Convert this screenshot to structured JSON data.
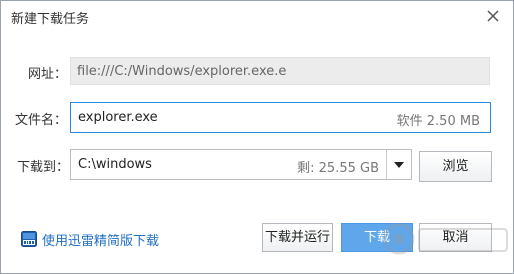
{
  "window": {
    "title": "新建下载任务",
    "close_icon": "close-icon"
  },
  "url_row": {
    "label": "网址：",
    "value": "file:///C:/Windows/explorer.exe.e"
  },
  "name_row": {
    "label": "文件名：",
    "value": "explorer.exe",
    "meta": "软件 2.50 MB"
  },
  "dir_row": {
    "label": "下载到：",
    "value": "C:\\windows",
    "free_space": "剩: 25.55 GB",
    "dropdown_icon": "caret-down-icon"
  },
  "buttons": {
    "browse": "浏览",
    "download_and_run": "下载并运行",
    "download": "下载",
    "cancel": "取消"
  },
  "footer": {
    "lite_icon": "xunlei-lite-icon",
    "lite_link": "使用迅雷精简版下载"
  },
  "colors": {
    "accent_blue": "#2c8ad8",
    "primary_button": "#5fa6eb",
    "link": "#1f6fc4",
    "readonly_bg": "#ececec"
  }
}
